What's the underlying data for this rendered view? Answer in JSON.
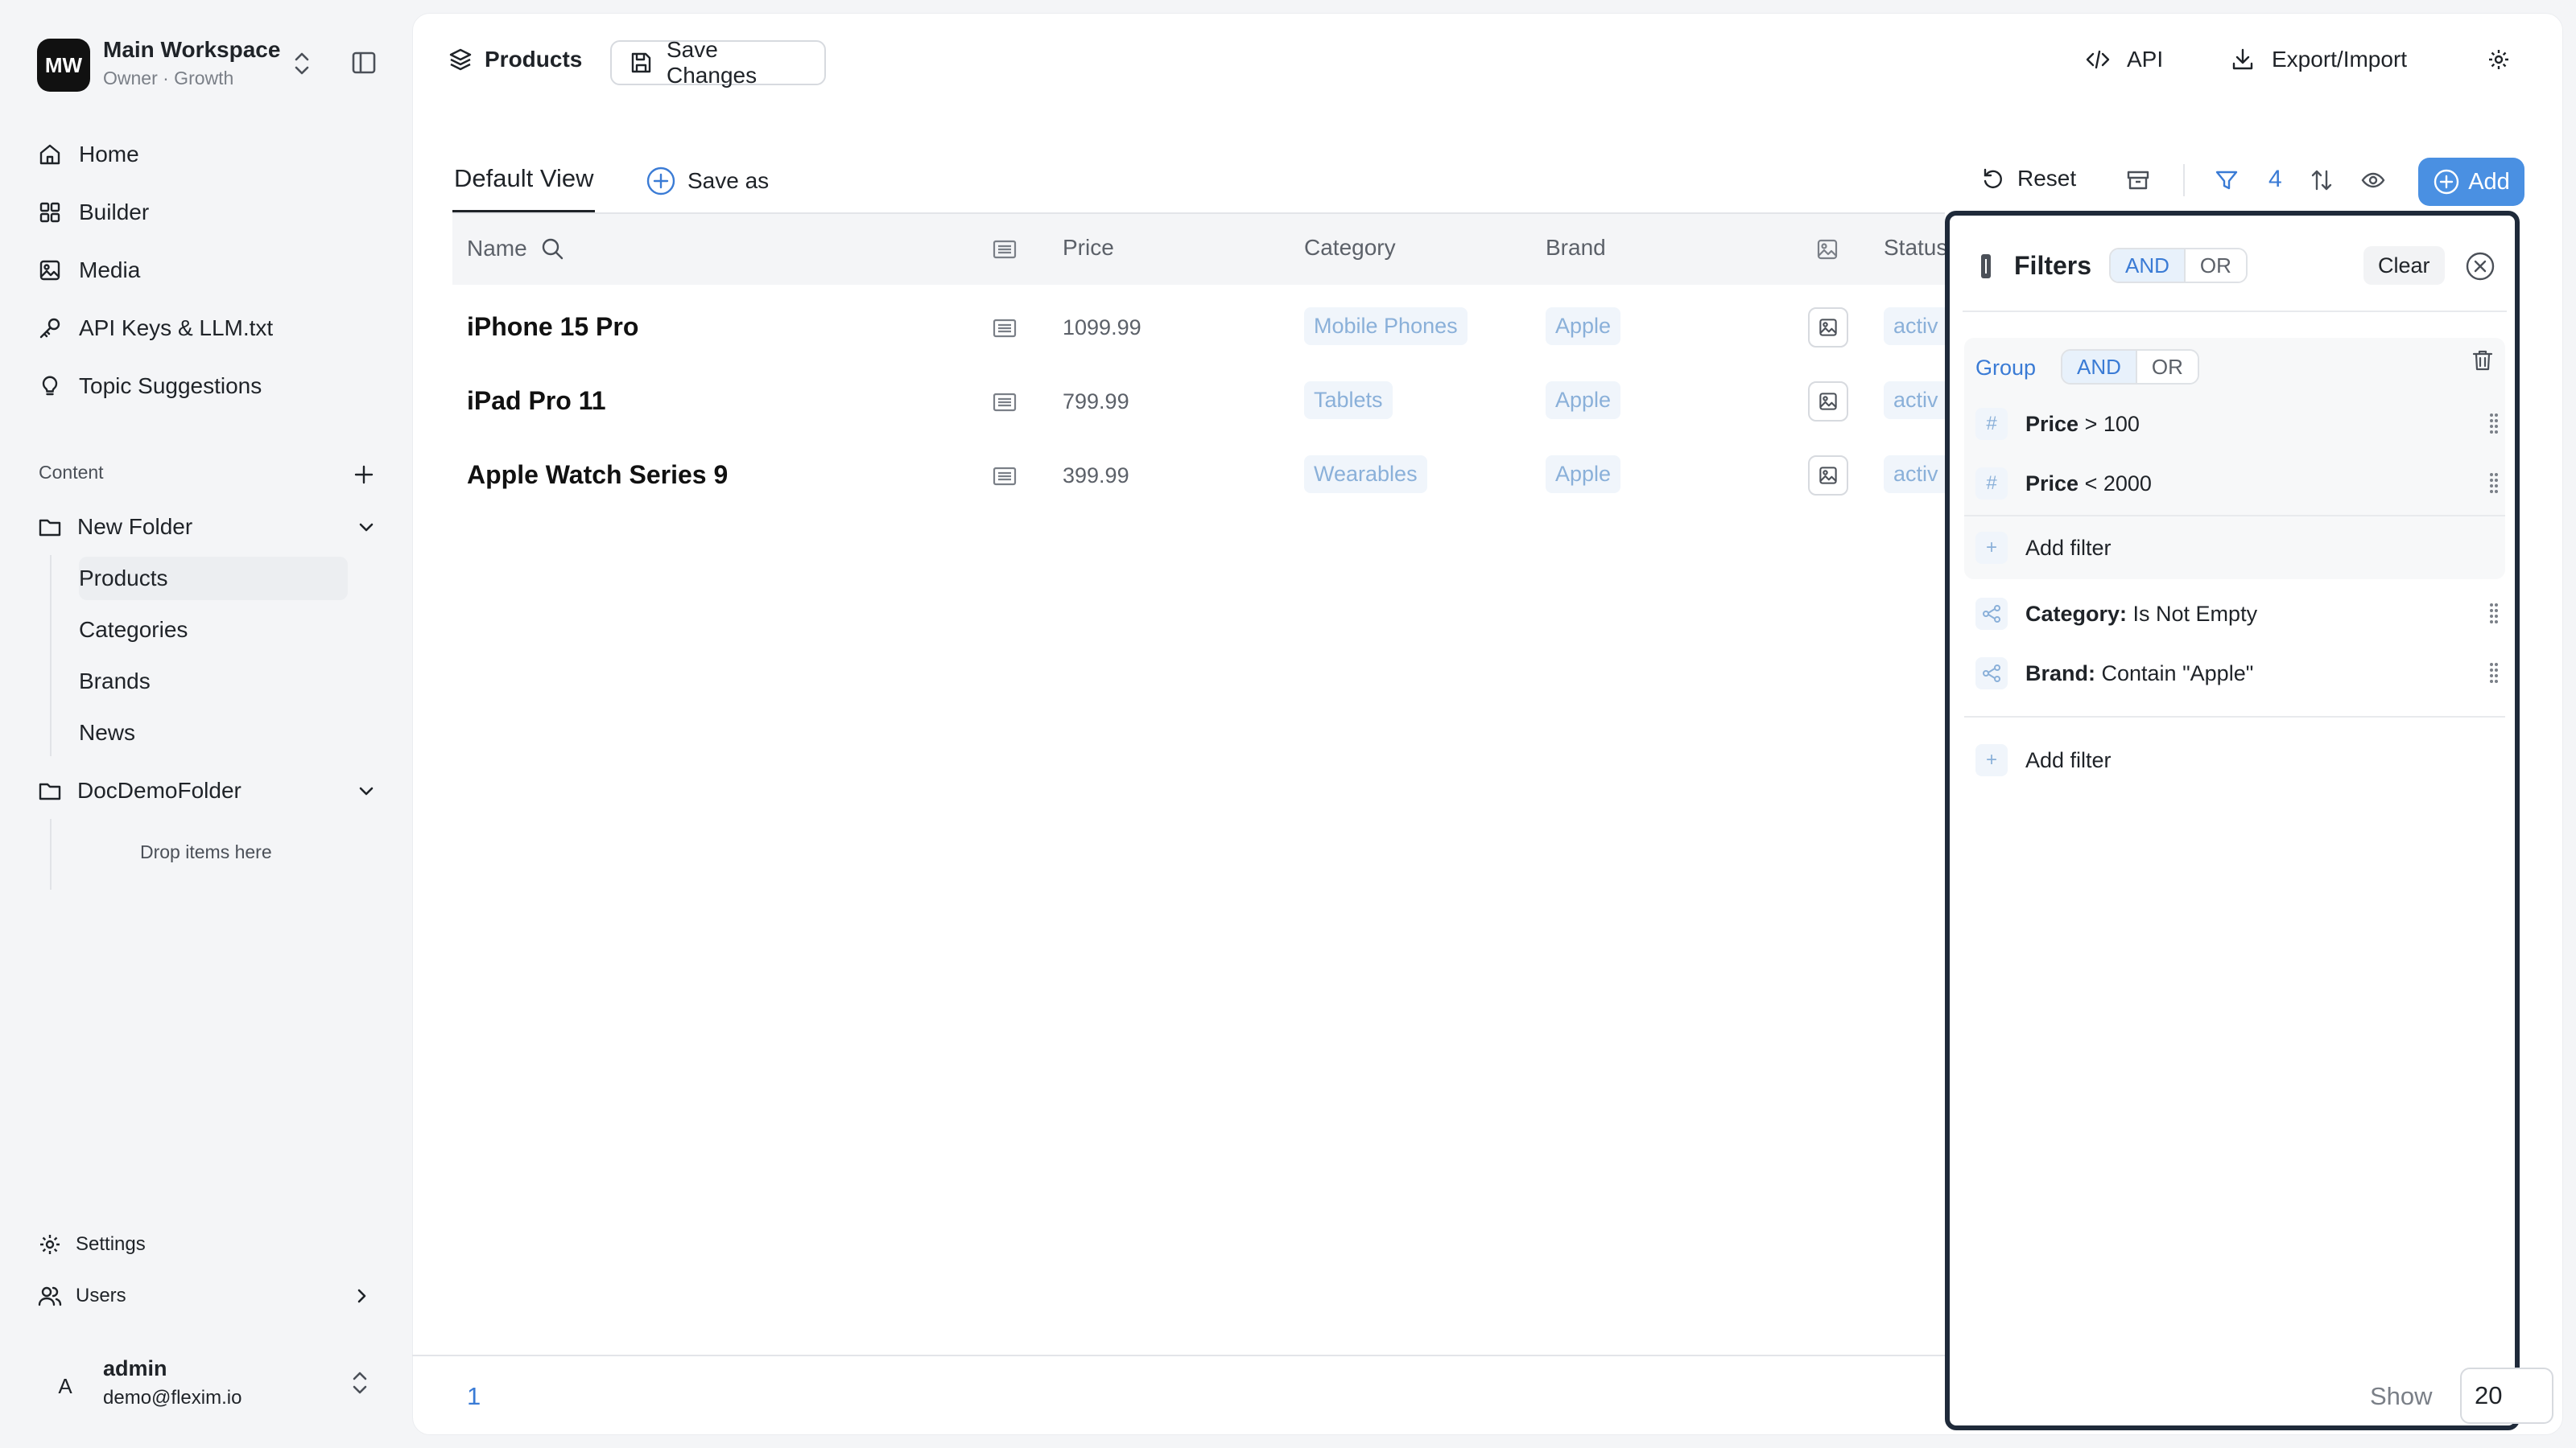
{
  "workspace": {
    "initials": "MW",
    "name": "Main Workspace",
    "subtitle": "Owner · Growth"
  },
  "nav": [
    {
      "label": "Home",
      "icon": "home-icon"
    },
    {
      "label": "Builder",
      "icon": "grid-icon"
    },
    {
      "label": "Media",
      "icon": "image-icon"
    },
    {
      "label": "API Keys & LLM.txt",
      "icon": "key-icon"
    },
    {
      "label": "Topic Suggestions",
      "icon": "lightbulb-icon"
    }
  ],
  "content": {
    "label": "Content",
    "folders": [
      {
        "name": "New Folder",
        "items": [
          "Products",
          "Categories",
          "Brands",
          "News"
        ]
      },
      {
        "name": "DocDemoFolder",
        "empty_text": "Drop items here"
      }
    ]
  },
  "bottom_nav": {
    "settings": "Settings",
    "users": "Users"
  },
  "user": {
    "initial": "A",
    "name": "admin",
    "email": "demo@flexim.io"
  },
  "header": {
    "title": "Products",
    "save": "Save Changes",
    "api": "API",
    "export_import": "Export/Import"
  },
  "view_bar": {
    "default_view": "Default View",
    "save_as": "Save as",
    "reset": "Reset",
    "filter_count": "4",
    "add": "Add"
  },
  "table": {
    "headers": {
      "name": "Name",
      "price": "Price",
      "category": "Category",
      "brand": "Brand",
      "status": "Status"
    },
    "rows": [
      {
        "name": "iPhone 15 Pro",
        "price": "1099.99",
        "category": "Mobile Phones",
        "brand": "Apple",
        "status": "activ"
      },
      {
        "name": "iPad Pro 11",
        "price": "799.99",
        "category": "Tablets",
        "brand": "Apple",
        "status": "activ"
      },
      {
        "name": "Apple Watch Series 9",
        "price": "399.99",
        "category": "Wearables",
        "brand": "Apple",
        "status": "activ"
      }
    ]
  },
  "pagination": {
    "page": "1",
    "show_label": "Show",
    "page_size": "20"
  },
  "filters": {
    "title": "Filters",
    "and": "AND",
    "or": "OR",
    "clear": "Clear",
    "group": {
      "label": "Group",
      "and": "AND",
      "or": "OR",
      "conditions": [
        {
          "field": "Price",
          "rest": " > 100"
        },
        {
          "field": "Price",
          "rest": " < 2000"
        }
      ],
      "add_filter": "Add filter"
    },
    "conditions": [
      {
        "field": "Category:",
        "rest": " Is Not Empty"
      },
      {
        "field": "Brand:",
        "rest": " Contain \"Apple\""
      }
    ],
    "add_filter": "Add filter"
  },
  "colors": {
    "accent": "#3a7bd5",
    "add_button": "#4a90e2",
    "panel_border": "#1f2a3a",
    "tag_text": "#8ab0d9"
  }
}
